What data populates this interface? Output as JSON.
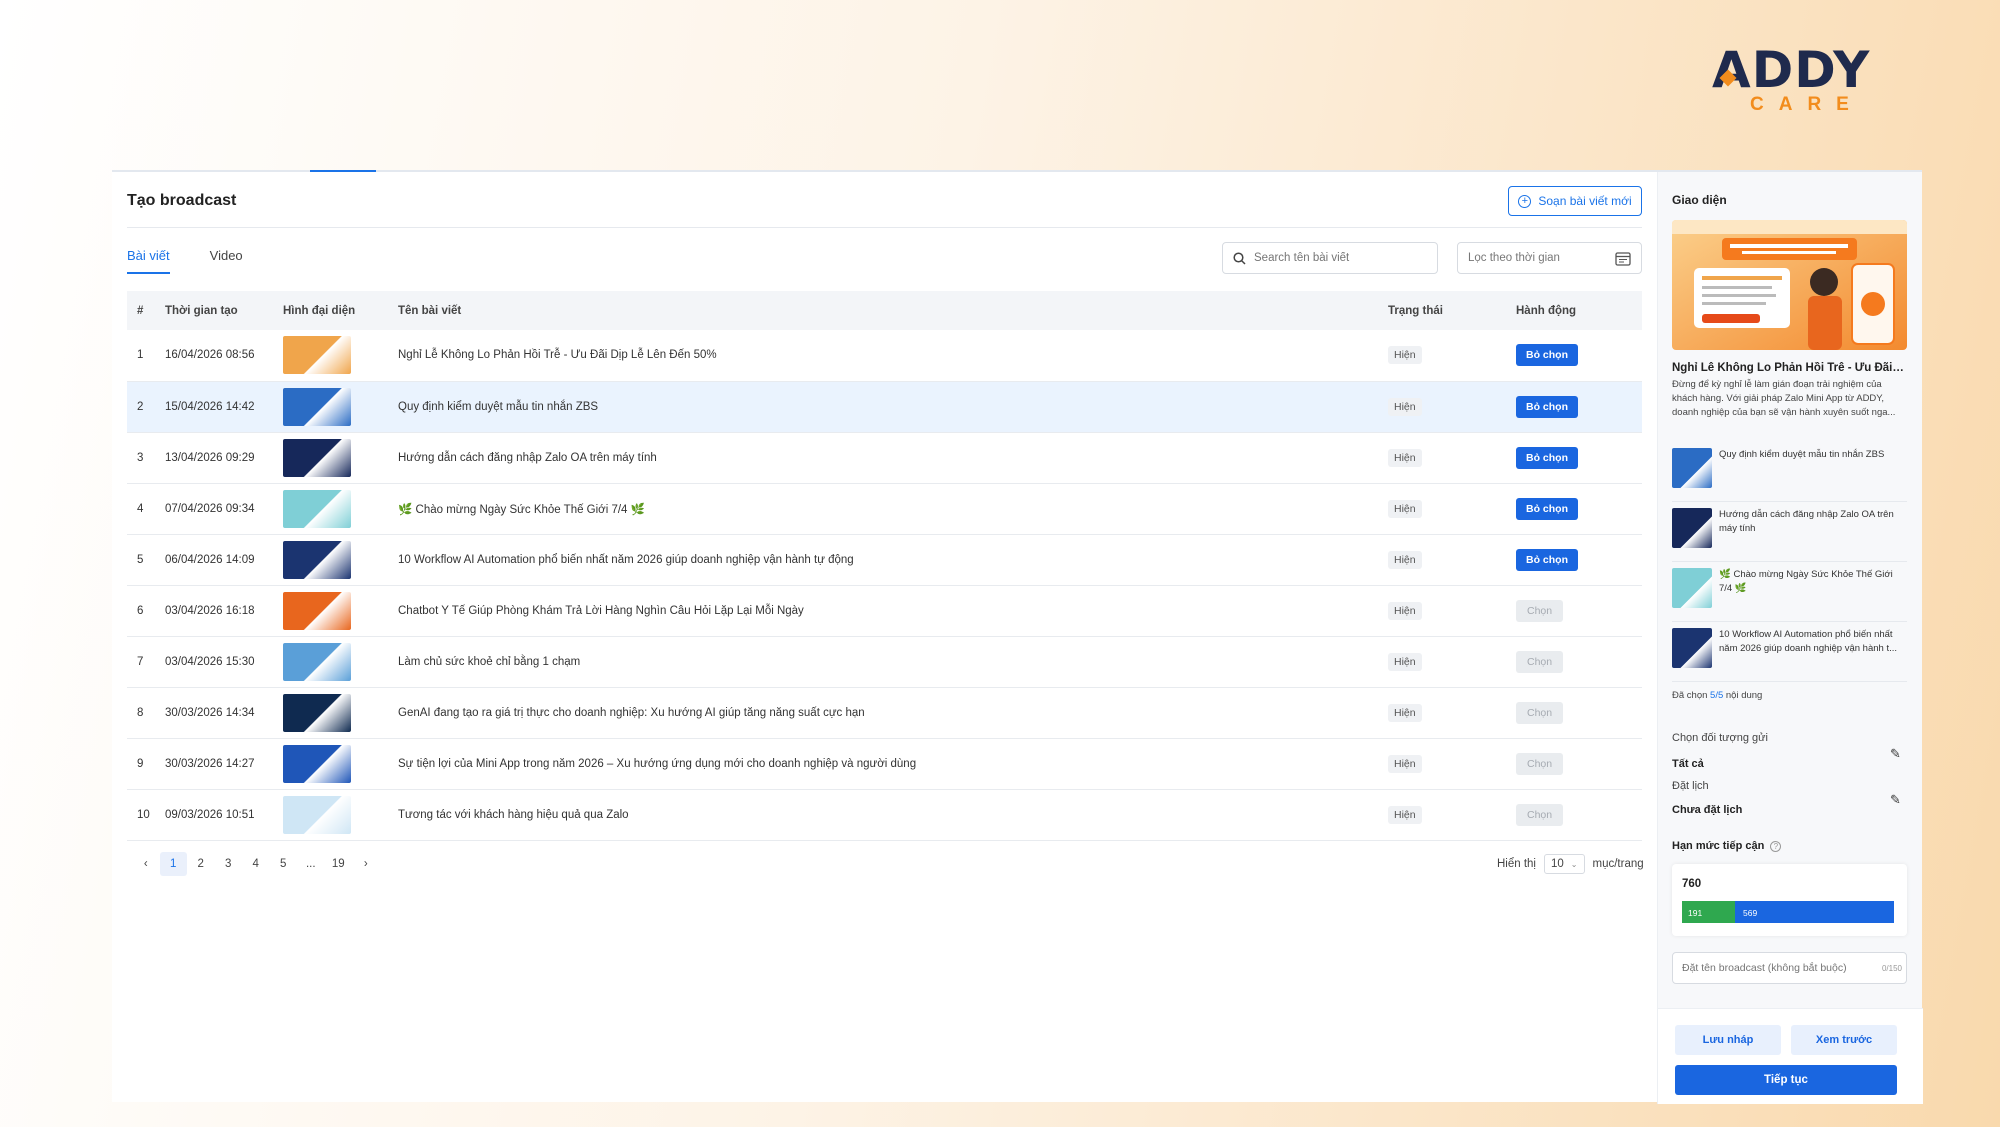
{
  "brand": {
    "logo_main": "ADDY",
    "logo_sub": "CARE"
  },
  "header": {
    "title": "Tạo broadcast",
    "compose_label": "Soạn bài viết mới"
  },
  "tabs": [
    {
      "label": "Bài viết",
      "active": true
    },
    {
      "label": "Video",
      "active": false
    }
  ],
  "search": {
    "placeholder": "Search tên bài viết"
  },
  "date_filter": {
    "placeholder": "Lọc theo thời gian"
  },
  "table": {
    "columns": [
      "#",
      "Thời gian tạo",
      "Hình đại diện",
      "Tên bài viết",
      "Trạng thái",
      "Hành động"
    ],
    "rows": [
      {
        "idx": "1",
        "time": "16/04/2026 08:56",
        "name": "Nghỉ Lễ Không Lo Phản Hồi Trễ - Ưu Đãi Dịp Lễ Lên Đến 50%",
        "status": "Hiện",
        "action": "Bỏ chọn",
        "selected": true,
        "highlight": false,
        "thumb": "#f0a54b"
      },
      {
        "idx": "2",
        "time": "15/04/2026 14:42",
        "name": "Quy định kiểm duyệt mẫu tin nhắn ZBS",
        "status": "Hiện",
        "action": "Bỏ chọn",
        "selected": true,
        "highlight": true,
        "thumb": "#2b6cc4"
      },
      {
        "idx": "3",
        "time": "13/04/2026 09:29",
        "name": "Hướng dẫn cách đăng nhập Zalo OA trên máy tính",
        "status": "Hiện",
        "action": "Bỏ chọn",
        "selected": true,
        "highlight": false,
        "thumb": "#16285a"
      },
      {
        "idx": "4",
        "time": "07/04/2026 09:34",
        "name": "🌿 Chào mừng Ngày Sức Khỏe Thế Giới 7/4 🌿",
        "status": "Hiện",
        "action": "Bỏ chọn",
        "selected": true,
        "highlight": false,
        "thumb": "#7fcfd6"
      },
      {
        "idx": "5",
        "time": "06/04/2026 14:09",
        "name": "10 Workflow AI Automation phổ biến nhất năm 2026 giúp doanh nghiệp vận hành tự động",
        "status": "Hiện",
        "action": "Bỏ chọn",
        "selected": true,
        "highlight": false,
        "thumb": "#1b3470"
      },
      {
        "idx": "6",
        "time": "03/04/2026 16:18",
        "name": "Chatbot Y Tế Giúp Phòng Khám Trả Lời Hàng Nghìn Câu Hỏi Lặp Lại Mỗi Ngày",
        "status": "Hiện",
        "action": "Chọn",
        "selected": false,
        "highlight": false,
        "thumb": "#e8661e"
      },
      {
        "idx": "7",
        "time": "03/04/2026 15:30",
        "name": "Làm chủ sức khoẻ chỉ bằng 1 chạm",
        "status": "Hiện",
        "action": "Chọn",
        "selected": false,
        "highlight": false,
        "thumb": "#5a9fd8"
      },
      {
        "idx": "8",
        "time": "30/03/2026 14:34",
        "name": "GenAI đang tạo ra giá trị thực cho doanh nghiệp: Xu hướng AI giúp tăng năng suất cực hạn",
        "status": "Hiện",
        "action": "Chọn",
        "selected": false,
        "highlight": false,
        "thumb": "#0f2a50"
      },
      {
        "idx": "9",
        "time": "30/03/2026 14:27",
        "name": "Sự tiện lợi của Mini App trong năm 2026 – Xu hướng ứng dụng mới cho doanh nghiệp và người dùng",
        "status": "Hiện",
        "action": "Chọn",
        "selected": false,
        "highlight": false,
        "thumb": "#1f56b8"
      },
      {
        "idx": "10",
        "time": "09/03/2026 10:51",
        "name": "Tương tác với khách hàng hiệu quả qua Zalo",
        "status": "Hiện",
        "action": "Chọn",
        "selected": false,
        "highlight": false,
        "thumb": "#cfe6f5"
      }
    ]
  },
  "pagination": {
    "pages": [
      "1",
      "2",
      "3",
      "4",
      "5",
      "...",
      "19"
    ],
    "current": "1",
    "show_label": "Hiển thị",
    "page_size": "10",
    "per_page_label": "mục/trang"
  },
  "panel": {
    "title": "Giao diện",
    "headline": "Nghỉ Lễ Không Lo Phản Hồi Trễ - Ưu Đãi Dị...",
    "description": "Đừng để kỳ nghỉ lễ làm gián đoạn trải nghiệm của khách hàng. Với giải pháp Zalo Mini App từ ADDY, doanh nghiệp của bạn sẽ vận hành xuyên suốt nga...",
    "items": [
      {
        "name": "Quy định kiểm duyệt mẫu tin nhắn ZBS",
        "thumb": "#2b6cc4"
      },
      {
        "name": "Hướng dẫn cách đăng nhập Zalo OA trên máy tính",
        "thumb": "#16285a"
      },
      {
        "name": "🌿 Chào mừng Ngày Sức Khỏe Thế Giới 7/4 🌿",
        "thumb": "#7fcfd6"
      },
      {
        "name": "10 Workflow AI Automation phổ biến nhất năm 2026 giúp doanh nghiệp vận hành t...",
        "thumb": "#1b3470"
      }
    ],
    "count_prefix": "Đã chọn",
    "count_value": "5/5",
    "count_suffix": "nội dung",
    "audience_label": "Chọn đối tượng gửi",
    "audience_value": "Tất cả",
    "schedule_label": "Đặt lịch",
    "schedule_value": "Chưa đặt lịch",
    "quota_label": "Hạn mức tiếp cận",
    "quota_total": "760",
    "quota_used": "191",
    "quota_remaining": "569",
    "quota_used_fraction": 0.25,
    "broadcast_name_placeholder": "Đặt tên broadcast (không bắt buộc)",
    "broadcast_name_counter": "0/150",
    "save_draft": "Lưu nháp",
    "preview": "Xem trước",
    "continue": "Tiếp tục"
  },
  "colors": {
    "primary": "#1a66e0",
    "accent": "#1a73e8",
    "quota_used": "#2fa84f",
    "brand_orange": "#f28c1c",
    "brand_navy": "#1f2a4d"
  }
}
